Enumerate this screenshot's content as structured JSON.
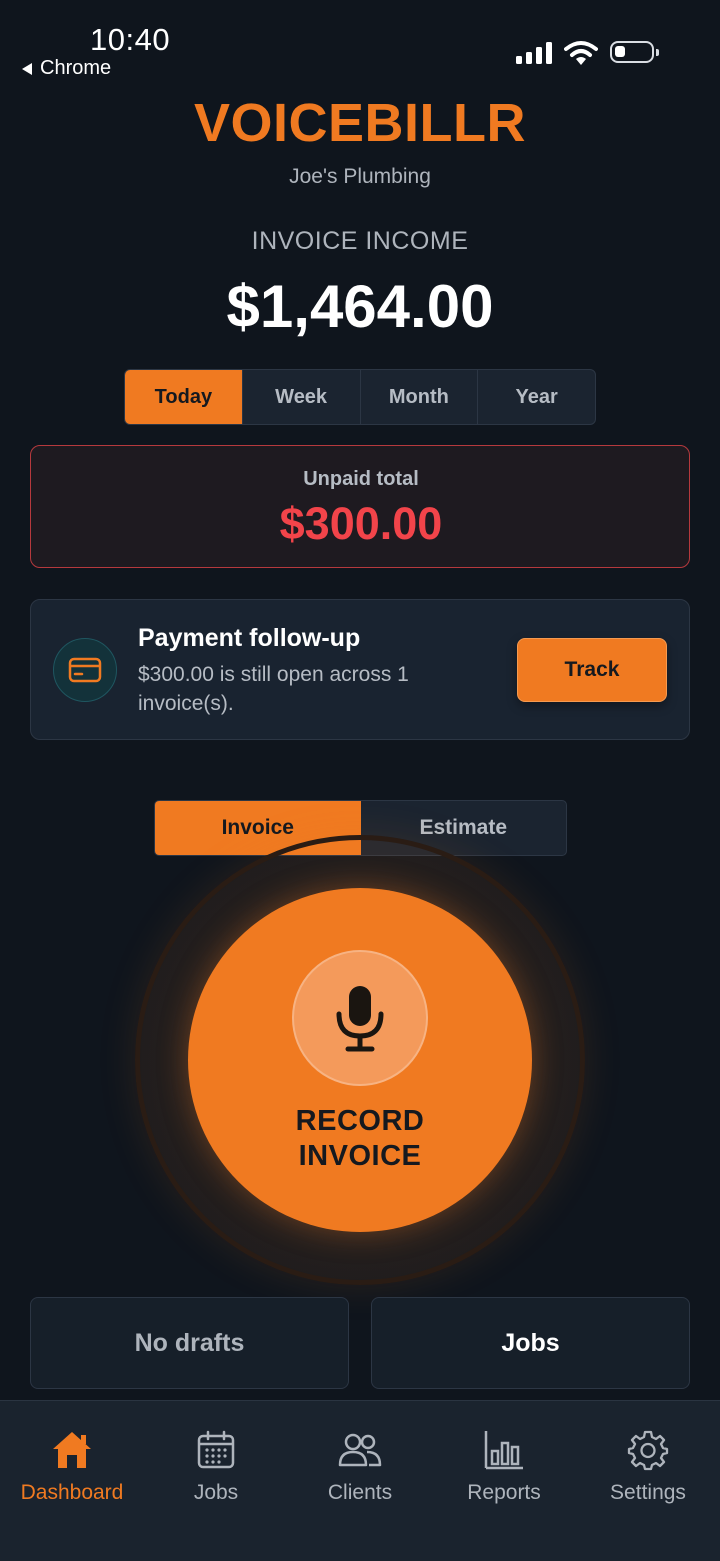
{
  "status_bar": {
    "time": "10:40",
    "back_app": "Chrome"
  },
  "brand": {
    "title": "VOICEBILLR",
    "business": "Joe's Plumbing"
  },
  "income": {
    "label": "INVOICE INCOME",
    "value": "$1,464.00"
  },
  "periods": {
    "items": [
      "Today",
      "Week",
      "Month",
      "Year"
    ],
    "selected": "Today"
  },
  "unpaid": {
    "label": "Unpaid total",
    "value": "$300.00"
  },
  "followup": {
    "title": "Payment follow-up",
    "text": "$300.00 is still open across 1 invoice(s).",
    "button": "Track",
    "icon": "credit-card-icon"
  },
  "mode": {
    "items": [
      "Invoice",
      "Estimate"
    ],
    "selected": "Invoice"
  },
  "record": {
    "label": "RECORD INVOICE",
    "icon": "microphone-icon"
  },
  "actions": {
    "drafts": "No drafts",
    "jobs": "Jobs"
  },
  "tabbar": {
    "items": [
      {
        "label": "Dashboard",
        "icon": "home-icon"
      },
      {
        "label": "Jobs",
        "icon": "calendar-icon"
      },
      {
        "label": "Clients",
        "icon": "users-icon"
      },
      {
        "label": "Reports",
        "icon": "bar-chart-icon"
      },
      {
        "label": "Settings",
        "icon": "gear-icon"
      }
    ],
    "selected": "Dashboard"
  },
  "colors": {
    "accent": "#f07a21",
    "danger": "#f2444a",
    "background": "#0f151d"
  }
}
